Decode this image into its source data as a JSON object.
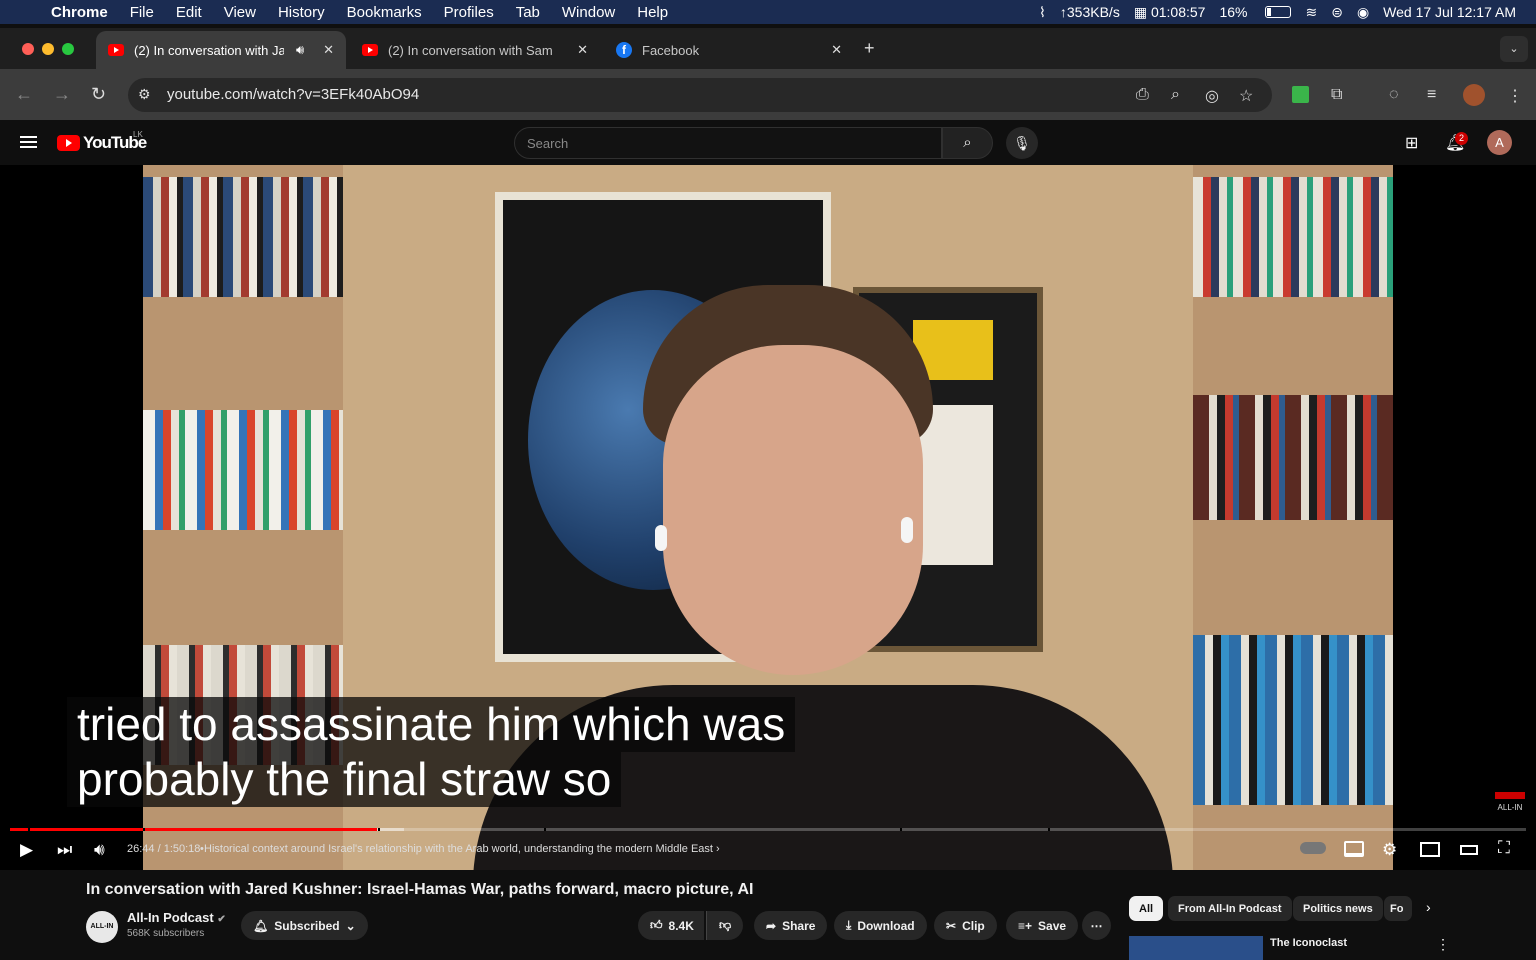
{
  "menubar": {
    "app": "Chrome",
    "items": [
      "File",
      "Edit",
      "View",
      "History",
      "Bookmarks",
      "Profiles",
      "Tab",
      "Window",
      "Help"
    ],
    "net_speed": "↑353KB/s",
    "timer": "01:08:57",
    "battery": "16%",
    "datetime": "Wed 17 Jul  12:17 AM"
  },
  "tabs": [
    {
      "title": "(2) In conversation with Ja",
      "active": true
    },
    {
      "title": "(2) In conversation with Sam",
      "active": false
    },
    {
      "title": "Facebook",
      "active": false
    }
  ],
  "address": {
    "url": "youtube.com/watch?v=3EFk40AbO94"
  },
  "youtube": {
    "logo_text": "YouTube",
    "country": "LK",
    "search_placeholder": "Search",
    "notification_count": "2",
    "avatar_letter": "A"
  },
  "video": {
    "caption_line1": "tried to assassinate him which was",
    "caption_line2": "probably the final straw so",
    "watermark": "ALL-IN",
    "time": "26:44 / 1:50:18",
    "chapter": "Historical context around Israel's relationship with the Arab world, understanding the modern Middle East",
    "progress_fraction": 0.242,
    "buffer_fraction": 0.26
  },
  "details": {
    "title": "In conversation with Jared Kushner: Israel-Hamas War, paths forward, macro picture, AI",
    "channel_name": "All-In Podcast",
    "channel_avatar_text": "ALL-IN",
    "subscribers": "568K subscribers",
    "subscribe_label": "Subscribed",
    "likes": "8.4K",
    "share_label": "Share",
    "download_label": "Download",
    "clip_label": "Clip",
    "save_label": "Save"
  },
  "chips": [
    "All",
    "From All-In Podcast",
    "Politics news",
    "Fo"
  ],
  "recommendation": {
    "title": "The Iconoclast"
  },
  "colors": {
    "youtube_red": "#ff0000",
    "background": "#0f0f0f",
    "menubar": "#1b2c52"
  }
}
